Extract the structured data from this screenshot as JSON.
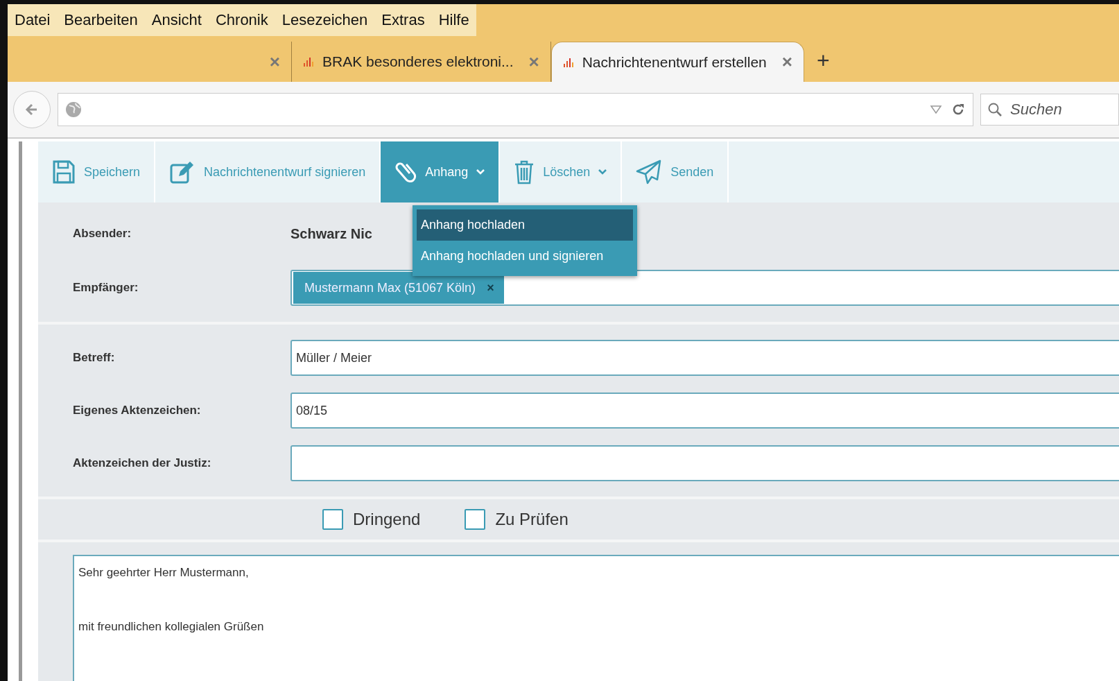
{
  "menu": [
    "Datei",
    "Bearbeiten",
    "Ansicht",
    "Chronik",
    "Lesezeichen",
    "Extras",
    "Hilfe"
  ],
  "tabs": [
    {
      "icon": false,
      "selected": false,
      "close": "×"
    },
    {
      "title": "BRAK besonderes elektroni...",
      "icon": true,
      "selected": false,
      "close": "×"
    },
    {
      "title": "Nachrichtenentwurf erstellen",
      "icon": true,
      "selected": true,
      "close": "×"
    }
  ],
  "new_tab": "+",
  "search": {
    "placeholder": "Suchen"
  },
  "toolbar": [
    {
      "kind": "save",
      "label": "Speichern",
      "dropdown": false,
      "selected": false
    },
    {
      "kind": "sign",
      "label": "Nachrichtenentwurf signieren",
      "dropdown": false,
      "selected": false
    },
    {
      "kind": "attach",
      "label": "Anhang",
      "dropdown": true,
      "selected": true
    },
    {
      "kind": "delete",
      "label": "Löschen",
      "dropdown": true,
      "selected": false
    },
    {
      "kind": "send",
      "label": "Senden",
      "dropdown": false,
      "selected": false
    }
  ],
  "dropdown_menu": [
    {
      "label": "Anhang hochladen",
      "selected": true
    },
    {
      "label": "Anhang hochladen und signieren",
      "selected": false
    }
  ],
  "sender": {
    "label": "Absender:",
    "value": "Schwarz Nic"
  },
  "recipient": {
    "label": "Empfänger:",
    "chip": "Mustermann Max (51067 Köln)",
    "remove": "×"
  },
  "fields": [
    {
      "label": "Betreff:",
      "value": "Müller / Meier"
    },
    {
      "label": "Eigenes Aktenzeichen:",
      "value": "08/15"
    },
    {
      "label": "Aktenzeichen der Justiz:"
    }
  ],
  "checkboxes": [
    {
      "label": "Dringend",
      "checked": false
    },
    {
      "label": "Zu Prüfen",
      "checked": false
    }
  ],
  "body_lines": [
    "Sehr geehrter Herr Mustermann,",
    "mit freundlichen kollegialen Grüßen"
  ]
}
